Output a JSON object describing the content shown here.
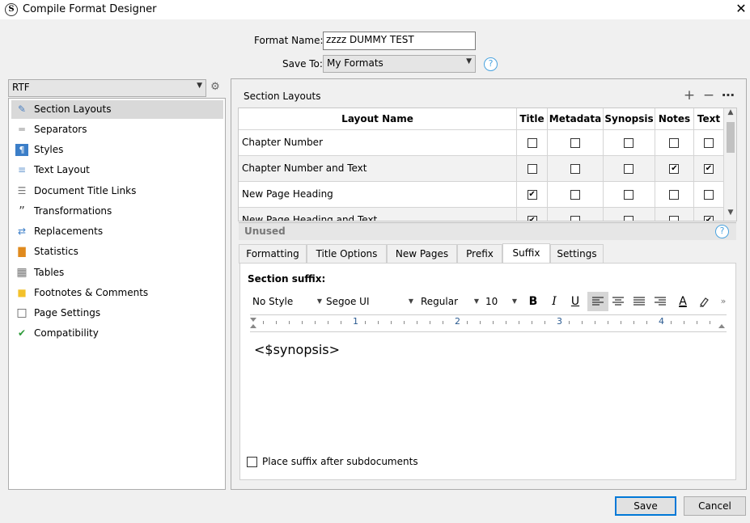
{
  "window": {
    "title": "Compile Format Designer",
    "close_glyph": "✕",
    "icon_letter": "S"
  },
  "header": {
    "format_name_label": "Format Name:",
    "format_name_value": "zzzz DUMMY TEST",
    "save_to_label": "Save To:",
    "save_to_value": "My Formats",
    "help_glyph": "?"
  },
  "sidebar": {
    "output_type": "RTF",
    "items": [
      {
        "label": "Section Layouts",
        "icon": "brush-icon",
        "glyph": "✎",
        "active": true
      },
      {
        "label": "Separators",
        "icon": "separator-icon",
        "glyph": "═"
      },
      {
        "label": "Styles",
        "icon": "styles-icon",
        "glyph": "¶"
      },
      {
        "label": "Text Layout",
        "icon": "text-layout-icon",
        "glyph": "≡"
      },
      {
        "label": "Document Title Links",
        "icon": "document-icon",
        "glyph": "☰"
      },
      {
        "label": "Transformations",
        "icon": "quotes-icon",
        "glyph": "”"
      },
      {
        "label": "Replacements",
        "icon": "replace-icon",
        "glyph": "⇄"
      },
      {
        "label": "Statistics",
        "icon": "bar-chart-icon",
        "glyph": "▇"
      },
      {
        "label": "Tables",
        "icon": "table-icon",
        "glyph": "▦"
      },
      {
        "label": "Footnotes & Comments",
        "icon": "comment-icon",
        "glyph": "■"
      },
      {
        "label": "Page Settings",
        "icon": "page-icon",
        "glyph": "□"
      },
      {
        "label": "Compatibility",
        "icon": "check-doc-icon",
        "glyph": "✔"
      }
    ]
  },
  "section_layouts": {
    "title": "Section Layouts",
    "add_glyph": "+",
    "remove_glyph": "−",
    "more_glyph": "⋯",
    "columns": [
      "Layout Name",
      "Title",
      "Metadata",
      "Synopsis",
      "Notes",
      "Text"
    ],
    "rows": [
      {
        "name": "Chapter Number",
        "checks": [
          false,
          false,
          false,
          false,
          false
        ]
      },
      {
        "name": "Chapter Number and Text",
        "checks": [
          false,
          false,
          false,
          true,
          true
        ]
      },
      {
        "name": "New Page Heading",
        "checks": [
          true,
          false,
          false,
          false,
          false
        ]
      },
      {
        "name": "New Page Heading and Text",
        "checks": [
          true,
          false,
          false,
          false,
          true
        ]
      }
    ],
    "unused_label": "Unused"
  },
  "tabs": [
    "Formatting",
    "Title Options",
    "New Pages",
    "Prefix",
    "Suffix",
    "Settings"
  ],
  "active_tab": "Suffix",
  "suffix": {
    "heading": "Section suffix:",
    "style_value": "No Style",
    "font_value": "Segoe UI",
    "weight_value": "Regular",
    "size_value": "10",
    "bold_glyph": "B",
    "italic_glyph": "I",
    "underline_glyph": "U",
    "color_glyph": "A",
    "more_glyph": "»",
    "ruler_numbers": [
      "1",
      "2",
      "3",
      "4"
    ],
    "editor_text": "<$synopsis>",
    "checkbox_label": "Place suffix after subdocuments",
    "checkbox_checked": false
  },
  "footer": {
    "save_label": "Save",
    "cancel_label": "Cancel"
  }
}
